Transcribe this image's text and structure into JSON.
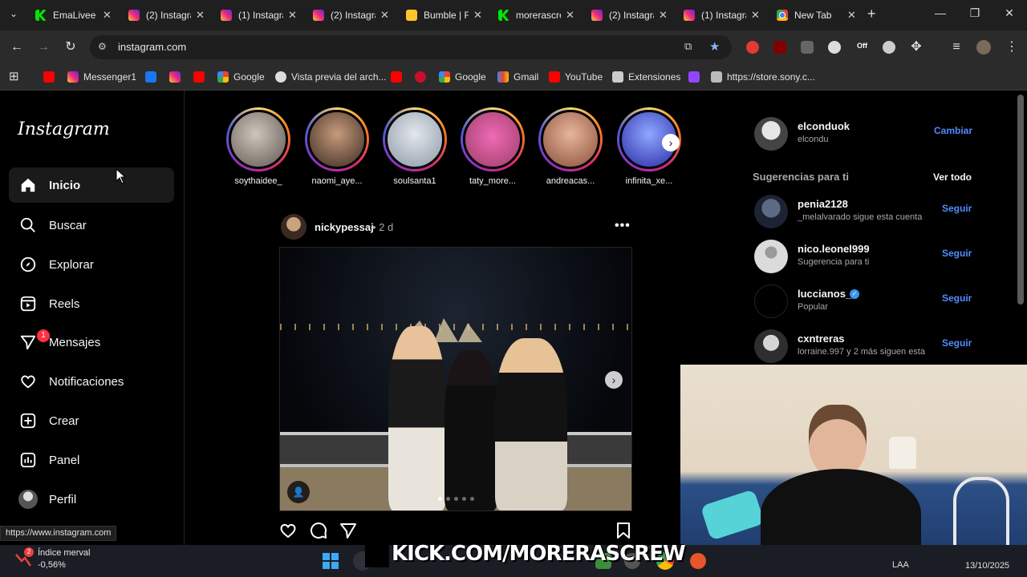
{
  "browser": {
    "tabs": [
      {
        "title": "EmaLivee",
        "icon": "kick-icon"
      },
      {
        "title": "(2) Instagram",
        "icon": "instagram-icon"
      },
      {
        "title": "(1) Instagram",
        "icon": "instagram-icon"
      },
      {
        "title": "(2) Instagram",
        "icon": "instagram-icon"
      },
      {
        "title": "Bumble | F",
        "icon": "bumble-icon"
      },
      {
        "title": "morerascrew",
        "icon": "kick-icon"
      },
      {
        "title": "(2) Instagram",
        "icon": "instagram-icon"
      },
      {
        "title": "(1) Instagram",
        "icon": "instagram-icon"
      },
      {
        "title": "New Tab",
        "icon": "chrome-icon"
      }
    ],
    "url": "instagram.com",
    "bookmarks": [
      {
        "label": "",
        "icon": "youtube-icon"
      },
      {
        "label": "Messenger1",
        "icon": "instagram-icon"
      },
      {
        "label": "",
        "icon": "facebook-icon"
      },
      {
        "label": "",
        "icon": "instagram-icon"
      },
      {
        "label": "",
        "icon": "youtube-icon"
      },
      {
        "label": "Google",
        "icon": "google-icon"
      },
      {
        "label": "Vista previa del arch...",
        "icon": "preview-icon"
      },
      {
        "label": "",
        "icon": "youtube-icon"
      },
      {
        "label": "",
        "icon": "opera-icon"
      },
      {
        "label": "Google",
        "icon": "google-icon"
      },
      {
        "label": "Gmail",
        "icon": "gmail-icon"
      },
      {
        "label": "YouTube",
        "icon": "youtube-icon"
      },
      {
        "label": "Extensiones",
        "icon": "puzzle-icon"
      },
      {
        "label": "",
        "icon": "twitch-icon"
      },
      {
        "label": "https://store.sony.c...",
        "icon": "sony-icon"
      }
    ],
    "ext_off_label": "Off",
    "status_url": "https://www.instagram.com"
  },
  "instagram": {
    "logo": "Instagram",
    "nav": [
      {
        "label": "Inicio",
        "icon": "home-icon",
        "active": true
      },
      {
        "label": "Buscar",
        "icon": "search-icon"
      },
      {
        "label": "Explorar",
        "icon": "compass-icon"
      },
      {
        "label": "Reels",
        "icon": "reels-icon"
      },
      {
        "label": "Mensajes",
        "icon": "messenger-icon",
        "badge": "1"
      },
      {
        "label": "Notificaciones",
        "icon": "heart-icon"
      },
      {
        "label": "Crear",
        "icon": "plus-square-icon"
      },
      {
        "label": "Panel",
        "icon": "chart-icon"
      },
      {
        "label": "Perfil",
        "icon": "avatar-icon"
      }
    ],
    "stories": [
      {
        "name": "soythaidee_"
      },
      {
        "name": "naomi_aye..."
      },
      {
        "name": "soulsanta1"
      },
      {
        "name": "taty_more..."
      },
      {
        "name": "andreacas..."
      },
      {
        "name": "infinita_xe..."
      }
    ],
    "post": {
      "user": "nickypessaj",
      "time": "• 2 d",
      "more": "•••",
      "carousel_dots": 5,
      "active_dot": 1
    },
    "account": {
      "username": "elconduok",
      "name": "elcondu",
      "switch_label": "Cambiar"
    },
    "suggestions_title": "Sugerencias para ti",
    "see_all": "Ver todo",
    "suggestions": [
      {
        "username": "penia2128",
        "sub": "_melalvarado sigue esta cuenta",
        "follow": "Seguir"
      },
      {
        "username": "nico.leonel999",
        "sub": "Sugerencia para ti",
        "follow": "Seguir"
      },
      {
        "username": "luccianos_",
        "sub": "Popular",
        "follow": "Seguir",
        "verified": true
      },
      {
        "username": "cxntreras",
        "sub": "lorraine.997 y 2 más siguen esta...",
        "follow": "Seguir"
      }
    ]
  },
  "taskbar": {
    "widget_name": "Índice merval",
    "widget_value": "-0,56%",
    "widget_badge": "2",
    "overlay_text": "KICK.COM/MORERASCREW",
    "lang": "LAA",
    "date": "13/10/2025"
  },
  "colors": {
    "accent_blue": "#4f8cff",
    "badge_red": "#ff3040",
    "story_ring": "#d62976"
  }
}
